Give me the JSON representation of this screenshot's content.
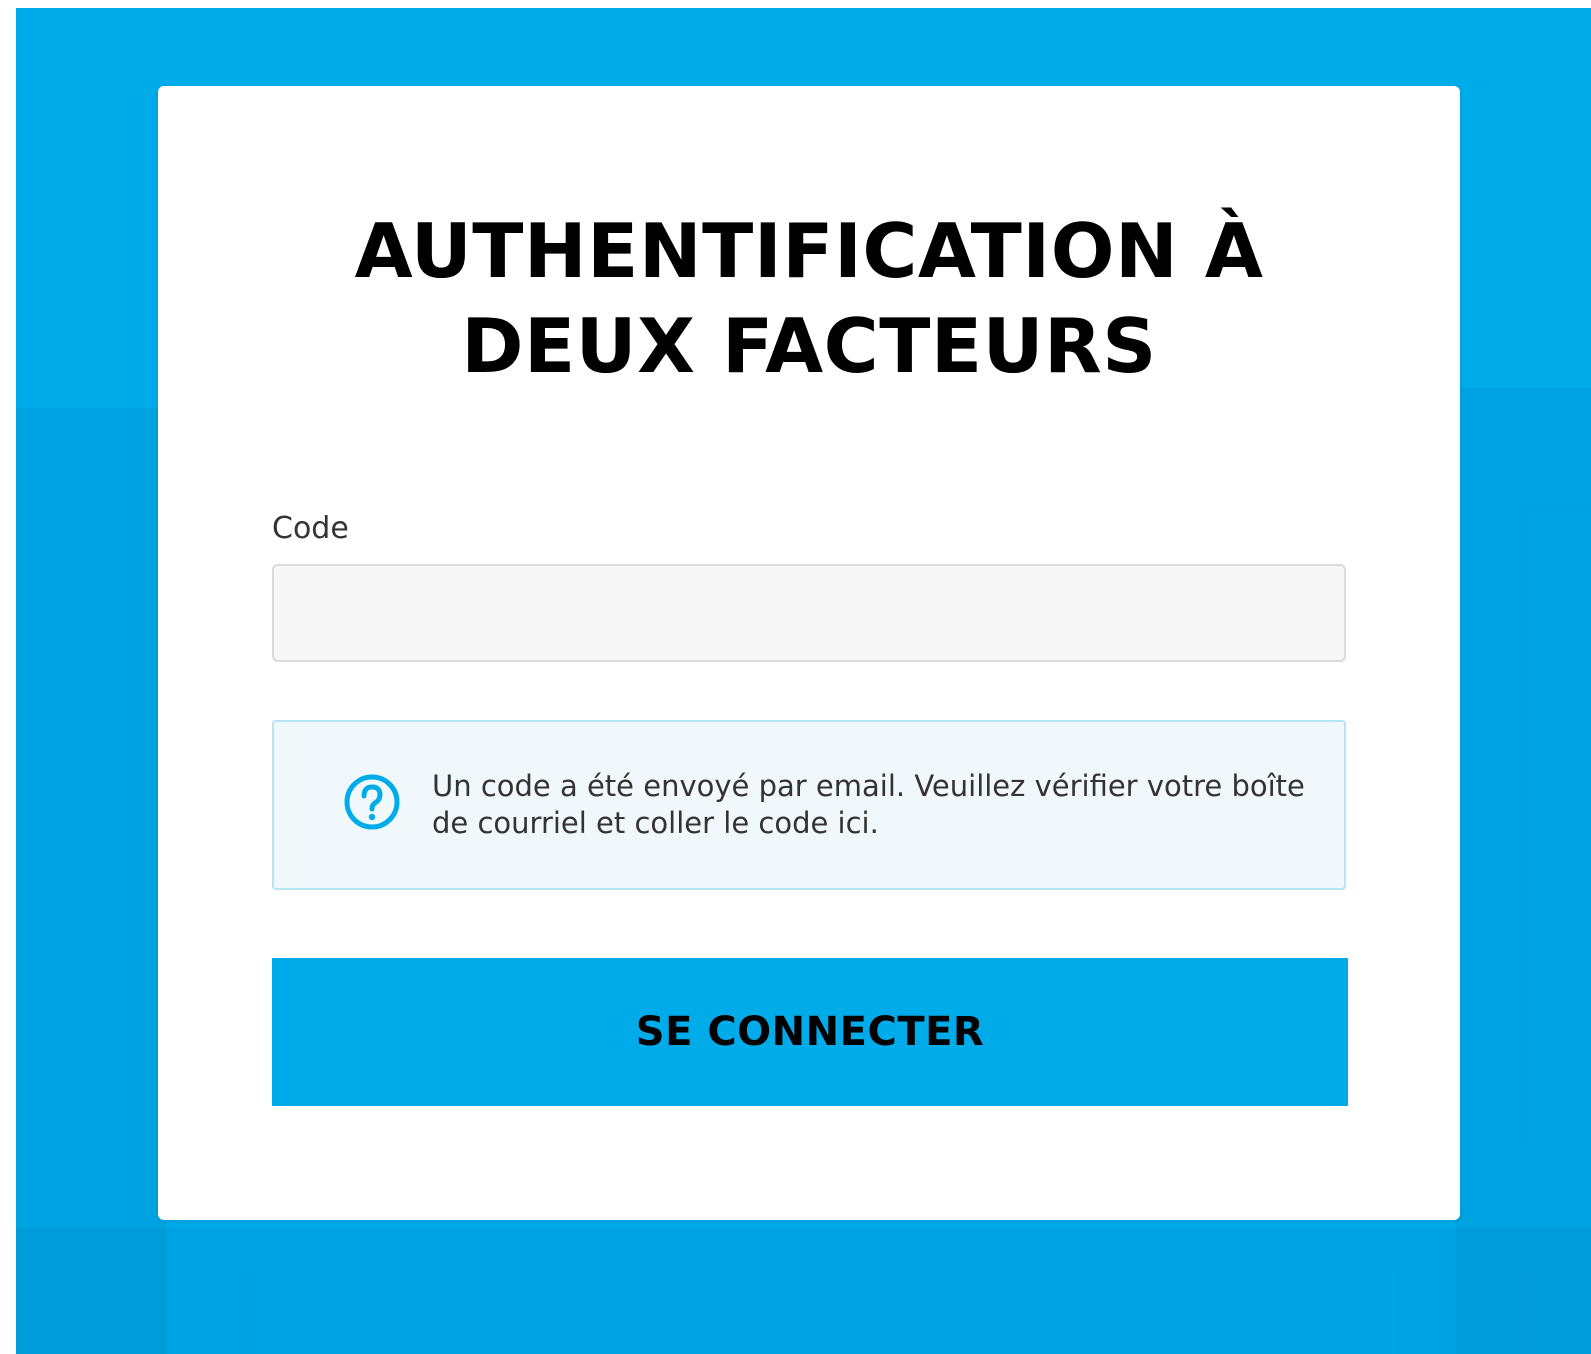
{
  "colors": {
    "background": "#00abe9",
    "card": "#ffffff",
    "button": "#00abe9",
    "accent": "#00abe9",
    "title_text": "#000000",
    "input_bg": "#f7f7f7",
    "info_bg": "#f0f8fc",
    "info_border": "#b8e4f6"
  },
  "form": {
    "title": "AUTHENTIFICATION À\nDEUX FACTEURS",
    "code_label": "Code",
    "code_value": "",
    "code_placeholder": ""
  },
  "info": {
    "icon": "help-circle-icon",
    "message": "Un code a été envoyé par email. Veuillez vérifier votre boîte de courriel et coller le code ici."
  },
  "actions": {
    "submit_label": "SE CONNECTER"
  }
}
